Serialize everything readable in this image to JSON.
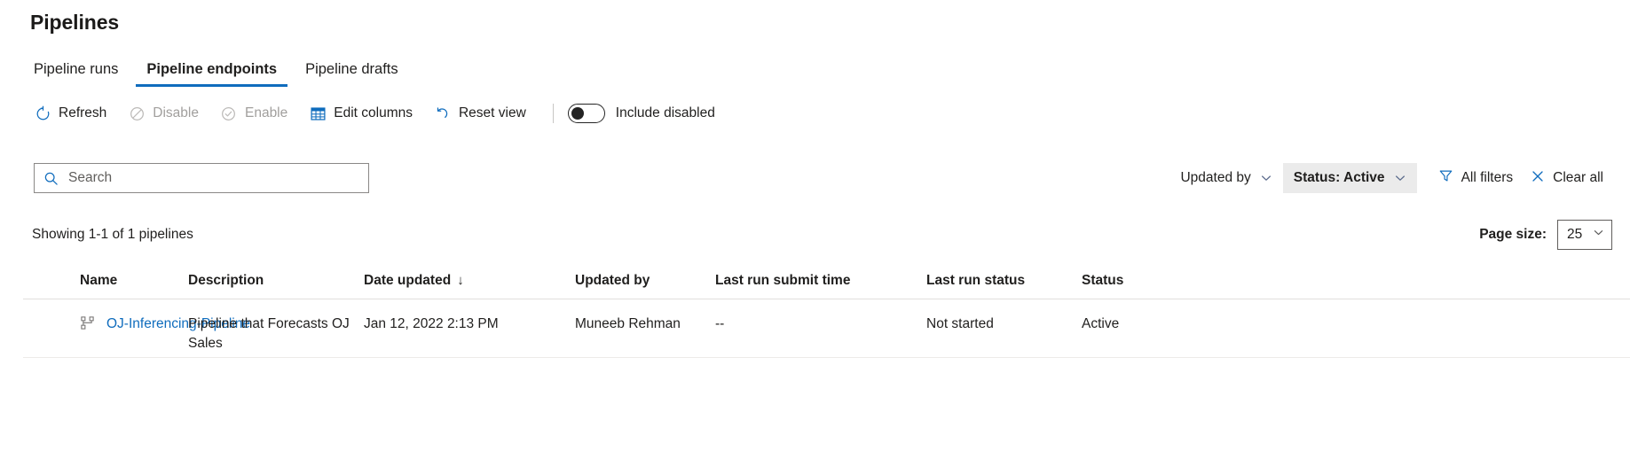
{
  "header": {
    "title": "Pipelines"
  },
  "tabs": [
    {
      "label": "Pipeline runs",
      "active": false
    },
    {
      "label": "Pipeline endpoints",
      "active": true
    },
    {
      "label": "Pipeline drafts",
      "active": false
    }
  ],
  "toolbar": {
    "refresh_label": "Refresh",
    "disable_label": "Disable",
    "enable_label": "Enable",
    "edit_columns_label": "Edit columns",
    "reset_view_label": "Reset view",
    "include_disabled_label": "Include disabled",
    "include_disabled_on": false
  },
  "search": {
    "placeholder": "Search",
    "value": ""
  },
  "filters": {
    "updated_by_label": "Updated by",
    "status_label": "Status: Active",
    "all_filters_label": "All filters",
    "clear_all_label": "Clear all"
  },
  "summary": {
    "showing_text": "Showing 1-1 of 1 pipelines",
    "page_size_label": "Page size:",
    "page_size_value": "25"
  },
  "table": {
    "columns": [
      "Name",
      "Description",
      "Date updated",
      "Updated by",
      "Last run submit time",
      "Last run status",
      "Status"
    ],
    "sort_column": "Date updated",
    "sort_arrow": "↓",
    "rows": [
      {
        "name": "OJ-Inferencing-Pipeline",
        "description": "Pipeline that Forecasts OJ Sales",
        "date_updated": "Jan 12, 2022 2:13 PM",
        "updated_by": "Muneeb Rehman",
        "last_run_submit_time": "--",
        "last_run_status": "Not started",
        "status": "Active"
      }
    ]
  },
  "colors": {
    "accent": "#0f6cbd",
    "text": "#201f1e",
    "disabled": "#a19f9d"
  }
}
